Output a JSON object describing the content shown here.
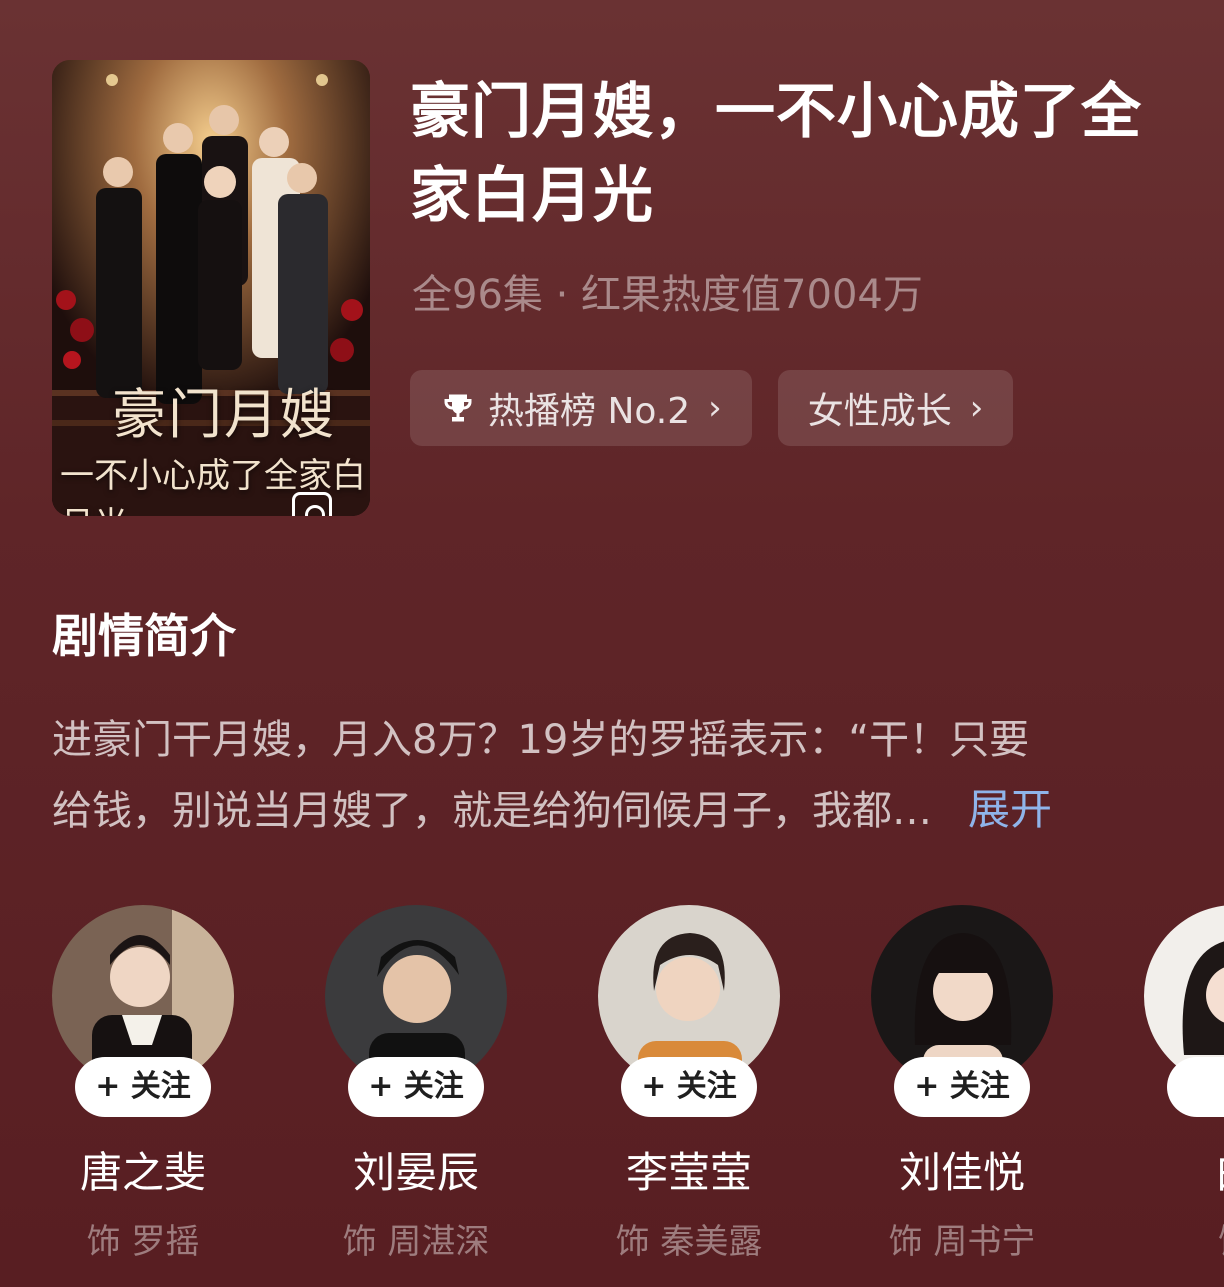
{
  "drama": {
    "title": "豪门月嫂，一不小心成了全家白月光",
    "meta": "全96集 · 红果热度值7004万",
    "poster_title_line1": "豪门月嫂",
    "poster_title_line2": "一不小心成了全家白月光"
  },
  "tags": [
    {
      "label": "热播榜 No.2",
      "icon": "trophy-icon"
    },
    {
      "label": "女性成长",
      "icon": ""
    }
  ],
  "synopsis": {
    "heading": "剧情简介",
    "line1": "进豪门干月嫂，月入8万？19岁的罗摇表示：“干！只要",
    "line2": "给钱，别说当月嫂了，就是给狗伺候月子，我都…",
    "expand_label": "展开"
  },
  "cast": [
    {
      "name": "唐之斐",
      "role": "饰 罗摇",
      "follow": "+ 关注"
    },
    {
      "name": "刘晏辰",
      "role": "饰 周湛深",
      "follow": "+ 关注"
    },
    {
      "name": "李莹莹",
      "role": "饰 秦美露",
      "follow": "+ 关注"
    },
    {
      "name": "刘佳悦",
      "role": "饰 周书宁",
      "follow": "+ 关注"
    },
    {
      "name": "白",
      "role": "饰",
      "follow": "+"
    }
  ],
  "colors": {
    "background": "#5f2528",
    "accent_link": "#8fb4ea",
    "follow_button": "#ffffff"
  }
}
